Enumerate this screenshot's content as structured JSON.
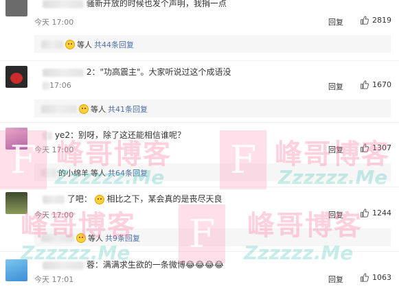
{
  "comments": [
    {
      "text": "骚新开放的时候也发个声明，我捐一点",
      "time": "今天 17:00",
      "reply_label": "回复",
      "likes": "2819",
      "sub": {
        "suffix": "等人",
        "total": "共44条回复"
      }
    },
    {
      "text": "2：\"功高震主\"。大家听说过这个成语没",
      "time": "17:06",
      "reply_label": "回复",
      "likes": "1670",
      "sub": {
        "suffix": "等人",
        "total": "共41条回复"
      }
    },
    {
      "text": "ye2：别呀，除了这还能相信谁呢？",
      "time": "今天 17:00",
      "reply_label": "回复",
      "likes": "1307",
      "sub": {
        "prefix": "的小绵羊",
        "suffix": "等人",
        "total": "共64条回复"
      }
    },
    {
      "text_a": "了吧：",
      "text_b": "相比之下，某会真的是丧尽天良",
      "time": "今天 17:00",
      "reply_label": "回复",
      "likes": "1244",
      "sub": {
        "suffix": "等人",
        "total": "共9条回复"
      }
    },
    {
      "text": "蓉：满满求生欲的一条微博😂😂😂😂",
      "time": "今天 17:01",
      "reply_label": "回复",
      "likes": "1063"
    }
  ],
  "watermark": {
    "cn": "峰哥博客",
    "en": "Zzzzzz.Me",
    "f": "F"
  },
  "colors": {
    "link": "#4c6ea8",
    "time": "#808080",
    "subbox": "#f6f6f6"
  },
  "icons": {
    "like": "thumbs-up-icon",
    "emoji": "emoji-face-icon"
  }
}
